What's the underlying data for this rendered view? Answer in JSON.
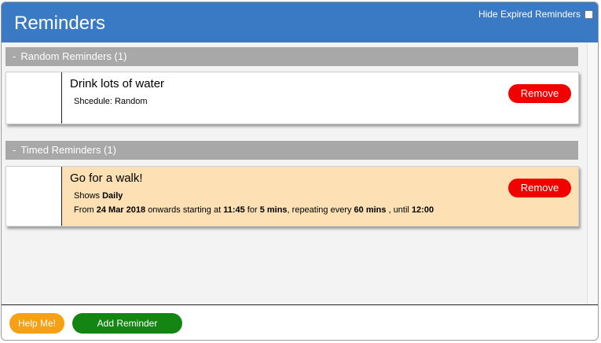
{
  "header": {
    "title": "Reminders",
    "hide_expired_label": "Hide Expired Reminders",
    "hide_expired_checked": false
  },
  "sections": [
    {
      "toggle": "-",
      "label": "Random Reminders (1)",
      "reminders": [
        {
          "title": "Drink lots of water",
          "schedule_label": "Shcedule: Random",
          "remove_label": "Remove"
        }
      ]
    },
    {
      "toggle": "-",
      "label": "Timed Reminders (1)",
      "reminders": [
        {
          "title": "Go for a walk!",
          "shows_prefix": "Shows",
          "shows_value": "Daily",
          "from_prefix": "From",
          "start_date": "24 Mar 2018",
          "onwards_text": "onwards starting at",
          "start_time": "11:45",
          "for_text": "for",
          "duration": "5 mins",
          "repeat_text": ", repeating every",
          "repeat_interval": "60 mins",
          "until_text": ", until",
          "end_time": "12:00",
          "remove_label": "Remove"
        }
      ]
    }
  ],
  "footer": {
    "help_label": "Help Me!",
    "add_label": "Add Reminder"
  },
  "colors": {
    "header_bg": "#3a7ac5",
    "section_bar": "#a8a8a8",
    "timed_card_bg": "#fde0b3",
    "remove_button": "#f20000",
    "help_button": "#f5a015",
    "add_button": "#128512"
  }
}
